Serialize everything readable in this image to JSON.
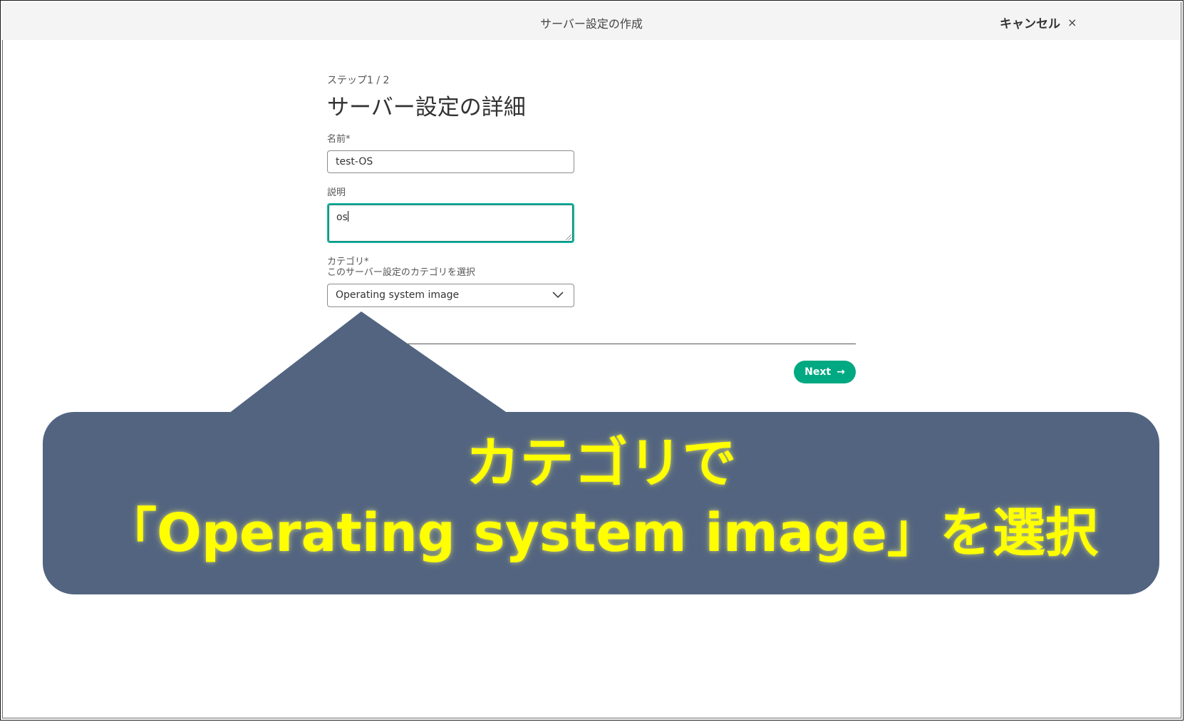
{
  "header": {
    "title": "サーバー設定の作成",
    "cancel_label": "キャンセル",
    "cancel_icon": "×"
  },
  "form": {
    "step": "ステップ1 / 2",
    "title": "サーバー設定の詳細",
    "name_label": "名前*",
    "name_value": "test-OS",
    "description_label": "説明",
    "description_value": "os",
    "category_label": "カテゴリ*",
    "category_hint": "このサーバー設定のカテゴリを選択",
    "category_value": "Operating system image",
    "next_label": "Next",
    "next_icon": "→"
  },
  "annotation": {
    "line1": "カテゴリで",
    "line2": "「Operating system image」を選択"
  },
  "colors": {
    "accent": "#01a982",
    "focus": "#18b3a1",
    "callout_bg": "#526480",
    "callout_text": "#ffff00"
  }
}
